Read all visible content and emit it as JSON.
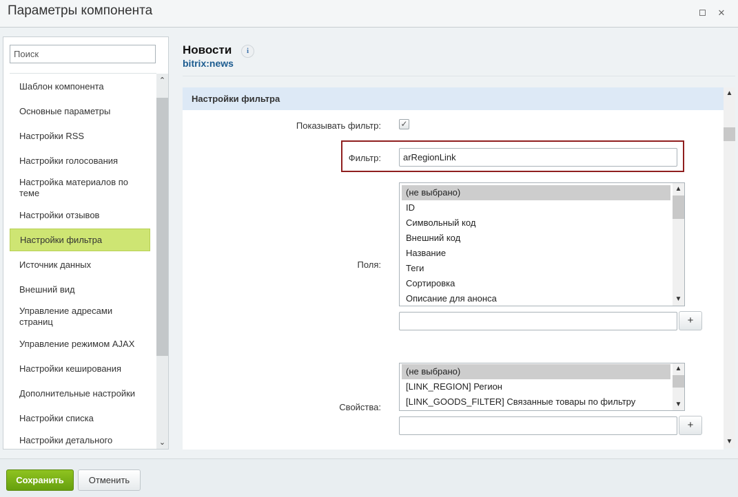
{
  "window": {
    "title": "Параметры компонента",
    "maximize_icon": "maximize-icon",
    "close_icon": "close-icon",
    "close_glyph": "✕"
  },
  "sidebar": {
    "search_placeholder": "Поиск",
    "scroll_up_glyph": "⌃",
    "scroll_down_glyph": "⌄",
    "items": [
      {
        "label": "Шаблон компонента"
      },
      {
        "label": "Основные параметры"
      },
      {
        "label": "Настройки RSS"
      },
      {
        "label": "Настройки голосования"
      },
      {
        "label": "Настройка материалов по теме"
      },
      {
        "label": "Настройки отзывов"
      },
      {
        "label": "Настройки фильтра",
        "active": true
      },
      {
        "label": "Источник данных"
      },
      {
        "label": "Внешний вид"
      },
      {
        "label": "Управление адресами страниц"
      },
      {
        "label": "Управление режимом AJAX"
      },
      {
        "label": "Настройки кеширования"
      },
      {
        "label": "Дополнительные настройки"
      },
      {
        "label": "Настройки списка"
      },
      {
        "label": "Настройки детального"
      }
    ]
  },
  "component": {
    "name": "Новости",
    "code": "bitrix:news",
    "info_glyph": "i"
  },
  "section": {
    "title": "Настройки фильтра",
    "show_filter": {
      "label": "Показывать фильтр:",
      "checked": true,
      "check_glyph": "✓"
    },
    "filter": {
      "label": "Фильтр:",
      "value": "arRegionLink"
    },
    "fields": {
      "label": "Поля:",
      "options": [
        "(не выбрано)",
        "ID",
        "Символьный код",
        "Внешний код",
        "Название",
        "Теги",
        "Сортировка",
        "Описание для анонса"
      ],
      "selected": "(не выбрано)",
      "extra_value": "",
      "add_label": "+"
    },
    "properties": {
      "label": "Свойства:",
      "options": [
        "(не выбрано)",
        "[LINK_REGION] Регион",
        "[LINK_GOODS_FILTER] Связанные товары по фильтру"
      ],
      "selected": "(не выбрано)",
      "extra_value": "",
      "add_label": "+"
    }
  },
  "footer": {
    "save_label": "Сохранить",
    "cancel_label": "Отменить"
  },
  "colors": {
    "accent_green": "#8fc320",
    "active_nav": "#cee573",
    "section_header": "#dde9f6",
    "highlight_border": "#8f1e1e",
    "link_blue": "#1b5b8f"
  }
}
